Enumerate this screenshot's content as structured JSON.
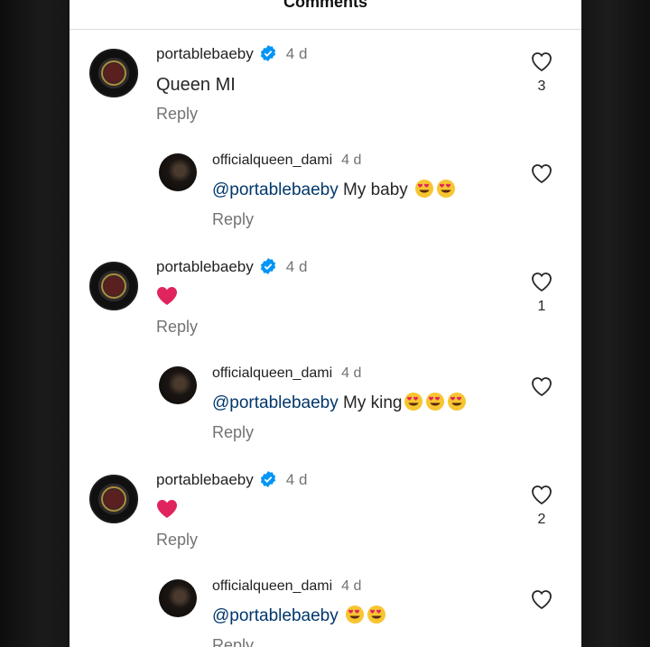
{
  "header": {
    "title": "Comments"
  },
  "comments": [
    {
      "username": "portablebaeby",
      "verified": true,
      "time": "4 d",
      "text": "Queen MI",
      "reply_label": "Reply",
      "likes": "3"
    },
    {
      "username": "officialqueen_dami",
      "verified": false,
      "time": "4 d",
      "mention": "@portablebaeby",
      "text": " My baby",
      "reply_label": "Reply",
      "likes": ""
    },
    {
      "username": "portablebaeby",
      "verified": true,
      "time": "4 d",
      "text": "",
      "reply_label": "Reply",
      "likes": "1"
    },
    {
      "username": "officialqueen_dami",
      "verified": false,
      "time": "4 d",
      "mention": "@portablebaeby",
      "text": " My king",
      "reply_label": "Reply",
      "likes": ""
    },
    {
      "username": "portablebaeby",
      "verified": true,
      "time": "4 d",
      "text": "",
      "reply_label": "Reply",
      "likes": "2"
    },
    {
      "username": "officialqueen_dami",
      "verified": false,
      "time": "4 d",
      "mention": "@portablebaeby",
      "text": "",
      "reply_label": "Reply",
      "likes": ""
    }
  ],
  "colors": {
    "mention": "#00376b",
    "verified": "#0095f6",
    "heart": "#e0245e",
    "muted": "#737373"
  }
}
